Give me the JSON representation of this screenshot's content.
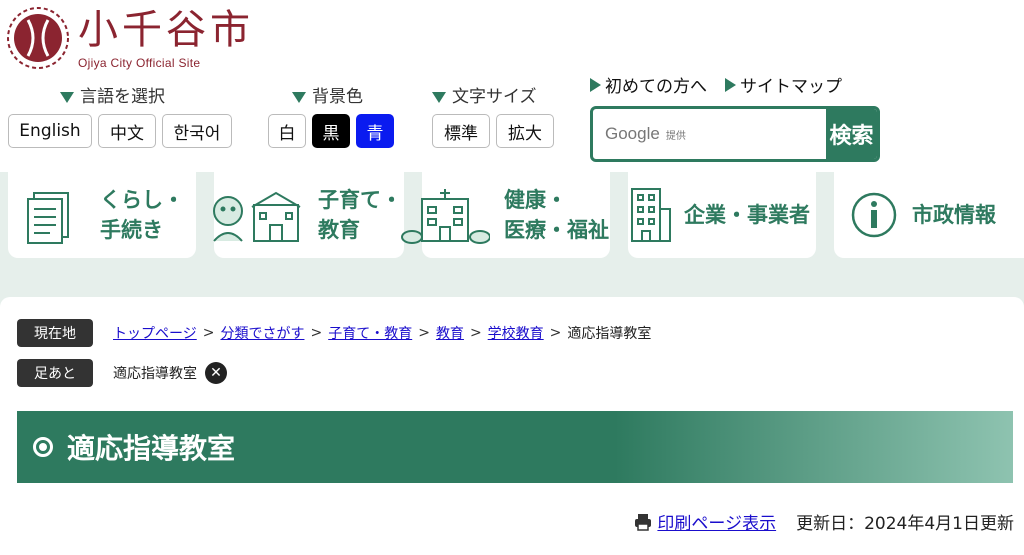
{
  "site": {
    "title": "小千谷市",
    "subtitle": "Ojiya City Official Site"
  },
  "language": {
    "label": "言語を選択",
    "options": [
      "English",
      "中文",
      "한국어"
    ]
  },
  "background": {
    "label": "背景色",
    "options": [
      "白",
      "黒",
      "青"
    ]
  },
  "fontsize": {
    "label": "文字サイズ",
    "options": [
      "標準",
      "拡大"
    ]
  },
  "quick_links": [
    "初めての方へ",
    "サイトマップ"
  ],
  "search": {
    "placeholder_main": "Google",
    "placeholder_sub": "提供",
    "button": "検索"
  },
  "nav": [
    {
      "line1": "くらし・",
      "line2": "手続き"
    },
    {
      "line1": "子育て・",
      "line2": "教育"
    },
    {
      "line1": "健康・",
      "line2": "医療・福祉"
    },
    {
      "line1": "企業・事業者",
      "line2": ""
    },
    {
      "line1": "市政情報",
      "line2": ""
    }
  ],
  "breadcrumb": {
    "label": "現在地",
    "links": [
      "トップページ",
      "分類でさがす",
      "子育て・教育",
      "教育",
      "学校教育"
    ],
    "current": "適応指導教室",
    "separator": ">"
  },
  "footprint": {
    "label": "足あと",
    "item": "適応指導教室"
  },
  "page_title": "適応指導教室",
  "print_label": "印刷ページ表示",
  "updated": "更新日：2024年4月1日更新",
  "colors": {
    "brand": "#8b2430",
    "accent": "#2e7a5f"
  }
}
